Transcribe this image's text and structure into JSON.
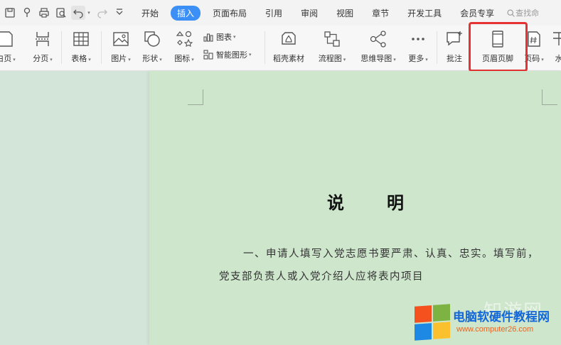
{
  "tabs": [
    "开始",
    "插入",
    "页面布局",
    "引用",
    "审阅",
    "视图",
    "章节",
    "开发工具",
    "会员专享"
  ],
  "active_tab_index": 1,
  "search_text": "查找命",
  "ribbon": {
    "blank_page": "白页",
    "page_break": "分页",
    "table": "表格",
    "picture": "图片",
    "shape": "形状",
    "icon": "图标",
    "chart": "图表",
    "smart_art": "智能图形",
    "docer_material": "稻壳素材",
    "flowchart": "流程图",
    "mind_map": "思维导图",
    "more": "更多",
    "comment": "批注",
    "header_footer": "页眉页脚",
    "page_number": "页码",
    "watermark": "水"
  },
  "document": {
    "title": "说明",
    "paragraph_line1": "一、申请人填写入党志愿书要严肃、认真、忠实。填写前，",
    "paragraph_line2": "党支部负责人或入党介绍人应将表内项目"
  },
  "watermark": {
    "ghost_text": "知游网",
    "title": "电脑软硬件教程网",
    "url": "www.computer26.com",
    "logo_colors": [
      "#f4511e",
      "#7cb342",
      "#1e88e5",
      "#fbc02d"
    ]
  },
  "colors": {
    "active_tab": "#3b8ff5",
    "highlight_box": "#e53232",
    "page_background": "#cee6cc",
    "side_background": "#d3e4d8"
  }
}
